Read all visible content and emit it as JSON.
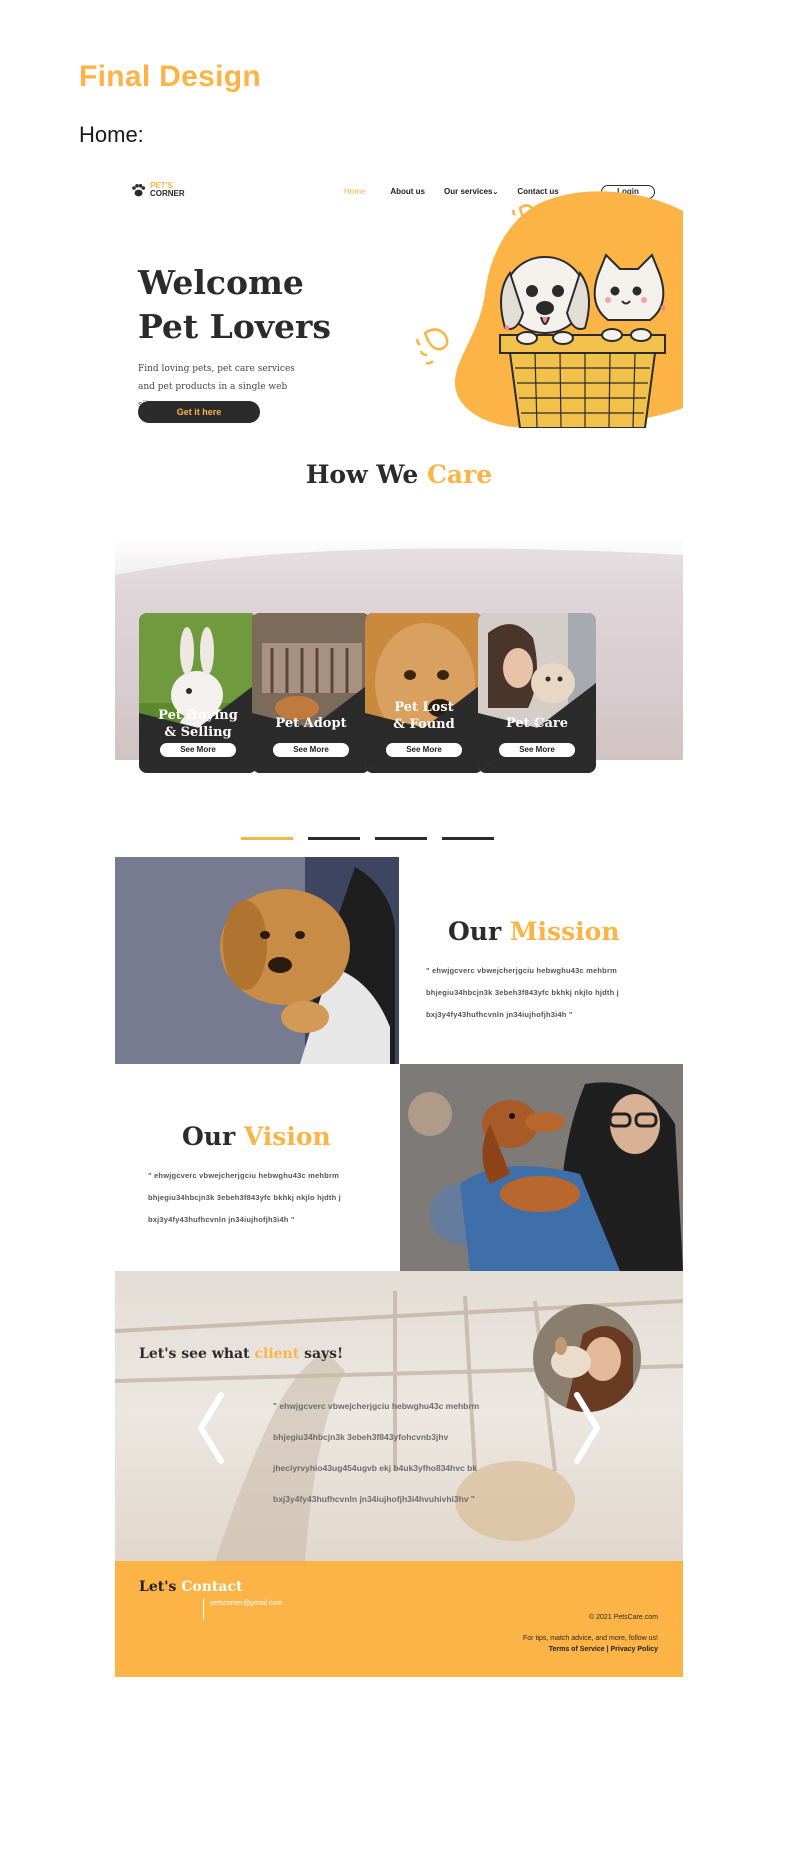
{
  "document": {
    "heading": "Final Design",
    "section": "Home:"
  },
  "nav": {
    "logo_top": "PET'S",
    "logo_bottom": "CORNER",
    "links": [
      "Home",
      "About us",
      "Our services",
      "Contact us"
    ],
    "services_caret": "⌄",
    "login": "Login"
  },
  "hero": {
    "title_line1": "Welcome",
    "title_line2": "Pet Lovers",
    "desc_line1": "Find loving pets, pet care services",
    "desc_line2": "and pet products in a single web site.",
    "cta": "Get it here"
  },
  "care": {
    "title_plain": "How We ",
    "title_accent": "Care",
    "cards": [
      {
        "line1": "Pet Buying",
        "line2": "& Selling",
        "button": "See More"
      },
      {
        "line1": "Pet Adopt",
        "line2": "",
        "button": "See More"
      },
      {
        "line1": "Pet Lost",
        "line2": "& Found",
        "button": "See More"
      },
      {
        "line1": "Pet Care",
        "line2": "",
        "button": "See More"
      }
    ],
    "slider": {
      "count": 4,
      "active": 0
    }
  },
  "mission": {
    "title_plain": "Our ",
    "title_accent": "Mission",
    "line1": "\" ehwjgcverc vbwejcherjgciu hebwghu43c mehbrm",
    "line2": "bhjegiu34hbcjn3k 3ebeh3f843yfc bkhkj nkjlo  hjdth j",
    "line3": "bxj3y4fy43hufhcvnln jn34iujhofjh3i4h \""
  },
  "vision": {
    "title_plain": "Our ",
    "title_accent": "Vision",
    "line1": "\" ehwjgcverc vbwejcherjgciu hebwghu43c mehbrm",
    "line2": "bhjegiu34hbcjn3k 3ebeh3f843yfc bkhkj nkjlo  hjdth j",
    "line3": "bxj3y4fy43hufhcvnln jn34iujhofjh3i4h \""
  },
  "testimonial": {
    "title_plain1": "Let's see what ",
    "title_accent": "client",
    "title_plain2": " says!",
    "line1": "\" ehwjgcverc vbwejcherjgciu hebwghu43c mehbrm",
    "line2": "bhjegiu34hbcjn3k 3ebeh3f843yfohcvnb3jhv",
    "line3": " jheciyrvyhio43ug454ugvb ekj  b4uk3yfho834hvc bk",
    "line4": "bxj3y4fy43hufhcvnln jn34iujhofjh3i4hvuhivhi3hv \""
  },
  "contact": {
    "title_plain": "Let's ",
    "title_accent": "Contact",
    "email": "petscorner@gmail.com",
    "copyright": "© 2021 PetsCare.com",
    "tips": "For tips, match advice, and more, follow us!",
    "terms": "Terms of Service",
    "separator": " | ",
    "privacy": "Privacy Policy"
  },
  "colors": {
    "accent": "#fcb446",
    "dark": "#2b2b2b",
    "white": "#ffffff"
  },
  "icons": [
    "paw-icon",
    "chevron-left-icon",
    "chevron-right-icon"
  ]
}
